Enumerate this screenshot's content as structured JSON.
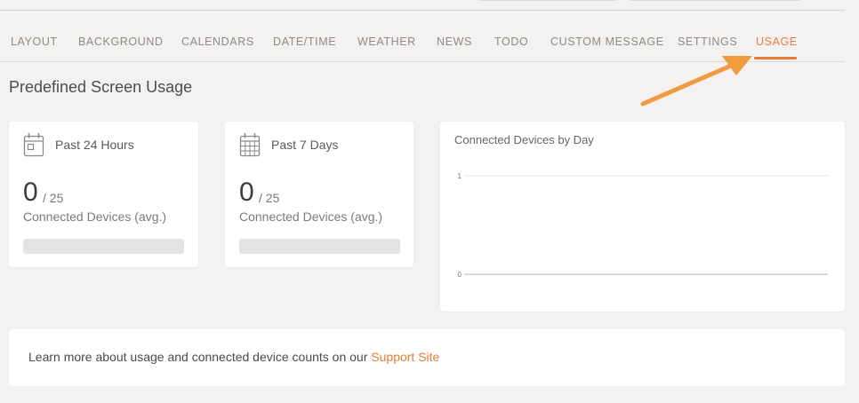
{
  "tabs": [
    "LAYOUT",
    "BACKGROUND",
    "CALENDARS",
    "DATE/TIME",
    "WEATHER",
    "NEWS",
    "TODO",
    "CUSTOM MESSAGE",
    "SETTINGS",
    "USAGE"
  ],
  "active_tab": "USAGE",
  "page_title": "Predefined Screen Usage",
  "cards": [
    {
      "title": "Past 24 Hours",
      "icon": "calendar-day-icon",
      "value": "0",
      "total": "/ 25",
      "subtitle": "Connected Devices (avg.)",
      "progress": 0
    },
    {
      "title": "Past 7 Days",
      "icon": "calendar-week-icon",
      "value": "0",
      "total": "/ 25",
      "subtitle": "Connected Devices (avg.)",
      "progress": 0
    }
  ],
  "chart_data": {
    "type": "line",
    "title": "Connected Devices by Day",
    "xlabel": "",
    "ylabel": "",
    "ylim": [
      0,
      1
    ],
    "y_ticks": [
      "1",
      "0"
    ],
    "series": [],
    "grid": true
  },
  "info": {
    "text": "Learn more about usage and connected device counts on our",
    "link_label": "Support Site"
  },
  "colors": {
    "accent": "#e67e3a",
    "background": "#f3f2f1",
    "card": "#ffffff"
  }
}
